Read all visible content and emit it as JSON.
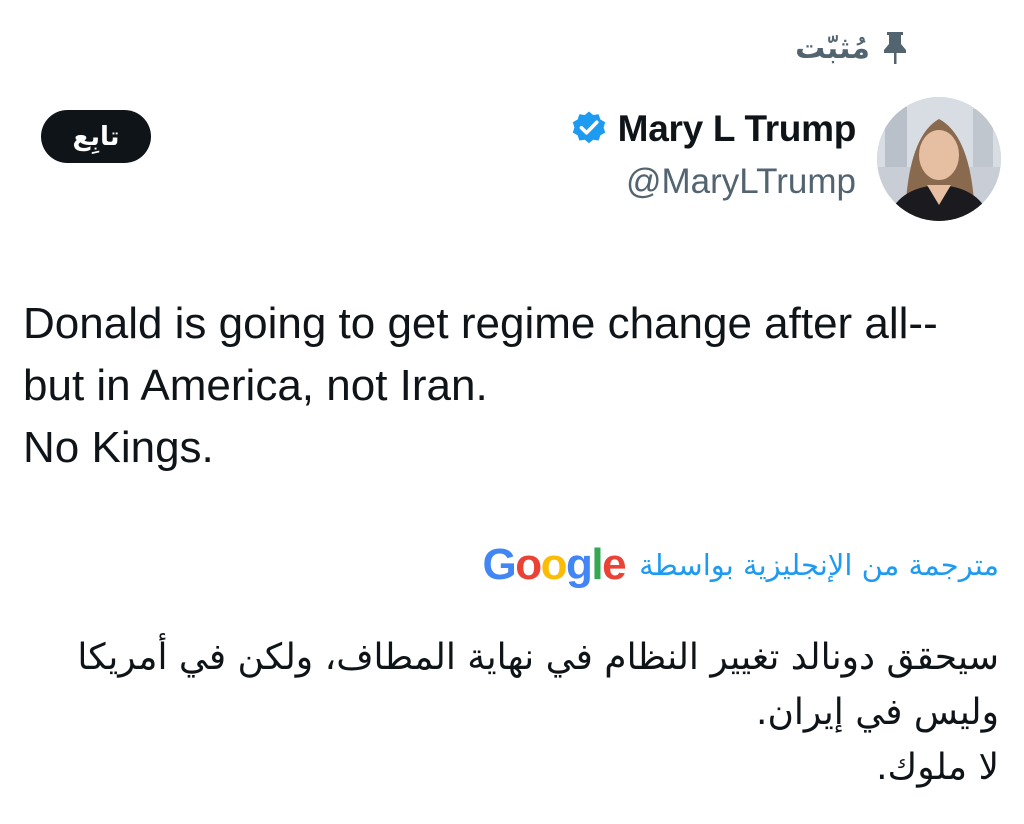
{
  "pinned": {
    "label": "مُثبّت",
    "icon": "pin-icon"
  },
  "author": {
    "display_name": "Mary L Trump",
    "handle": "@MaryLTrump",
    "verified_icon": "verified-badge-icon",
    "avatar_icon": "profile-avatar"
  },
  "follow_button": {
    "label": "تابِع"
  },
  "tweet": {
    "lines": [
      "Donald is going to get regime change after all--",
      "but in America, not Iran.",
      "No Kings."
    ]
  },
  "translation": {
    "label": "مترجمة من الإنجليزية بواسطة",
    "provider_letters": [
      "G",
      "o",
      "o",
      "g",
      "l",
      "e"
    ],
    "provider_colors": [
      "#4285F4",
      "#EA4335",
      "#FBBC05",
      "#4285F4",
      "#34A853",
      "#EA4335"
    ],
    "lines": [
      "سيحقق دونالد تغيير النظام في نهاية المطاف، ولكن في أمريكا",
      "وليس في إيران.",
      "لا ملوك."
    ]
  },
  "colors": {
    "accent": "#1d9bf0",
    "text_primary": "#0f1419",
    "text_secondary": "#536471",
    "button_bg": "#0f1419"
  }
}
